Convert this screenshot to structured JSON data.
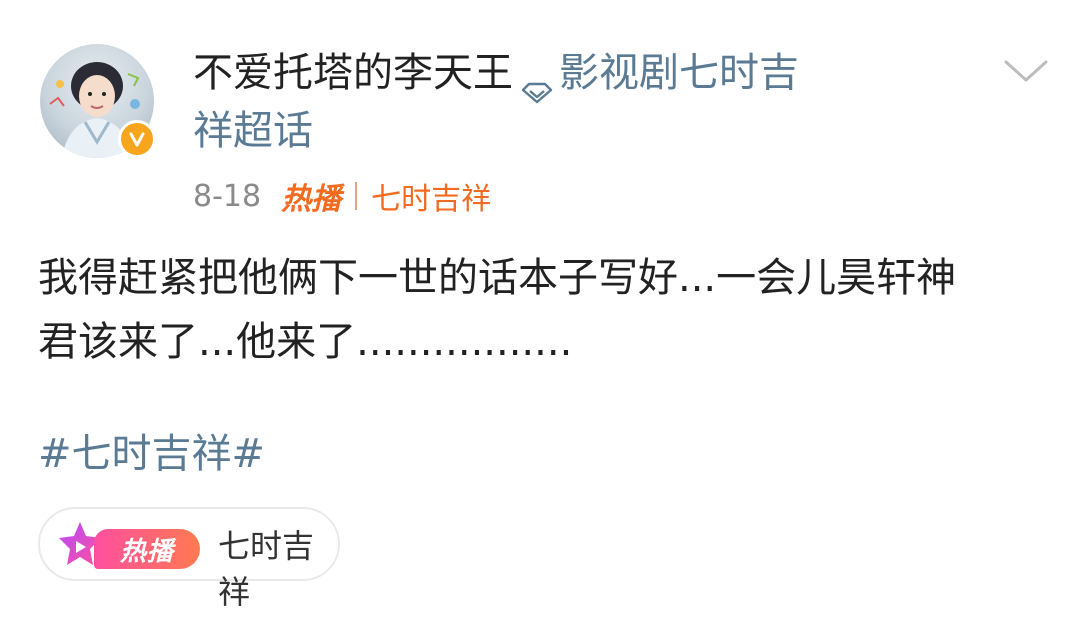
{
  "post": {
    "author": {
      "username": "不爱托塔的李天王",
      "verified_badge_color": "#f7a51c"
    },
    "topic": {
      "line1": "影视剧七时吉",
      "line2": "祥超话",
      "color": "#5b7a94"
    },
    "meta": {
      "date": "8-18",
      "hot_label": "热播",
      "topic_name": "七时吉祥",
      "accent_color": "#f26b21"
    },
    "content": {
      "line1": "我得赶紧把他俩下一世的话本子写好...一会儿昊轩神",
      "line2": "君该来了...他来了.................",
      "hashtag": "#七时吉祥#"
    },
    "hot_pill": {
      "badge": "热播",
      "label": "七时吉祥"
    },
    "icons": {
      "topic": "diamond-icon",
      "menu": "chevron-down-icon",
      "pill": "play-star-icon"
    }
  }
}
